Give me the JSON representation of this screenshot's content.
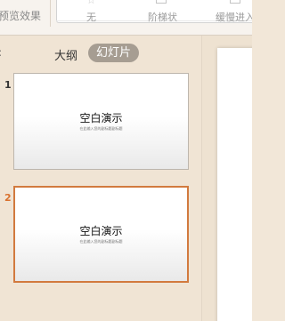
{
  "ribbon": {
    "preview_label": "预览效果",
    "transitions": [
      {
        "label": "无",
        "icon": "star-icon"
      },
      {
        "label": "阶梯状",
        "icon": "stairs-icon"
      },
      {
        "label": "缓慢进入",
        "icon": "fade-in-icon"
      }
    ]
  },
  "pane": {
    "tab_colon": ":",
    "tabs": {
      "outline": "大纲",
      "slides": "幻灯片",
      "active": "slides"
    }
  },
  "slides": [
    {
      "number": "1",
      "title": "空白演示",
      "subtitle": "在此输入您的副标题副标题",
      "selected": false
    },
    {
      "number": "2",
      "title": "空白演示",
      "subtitle": "在此输入您的副标题副标题",
      "selected": true
    }
  ],
  "colors": {
    "pane_bg": "#f0e4d4",
    "tab_active_bg": "#a69d92",
    "selection": "#d27a3e",
    "thumb_border": "#bdb6ad"
  }
}
